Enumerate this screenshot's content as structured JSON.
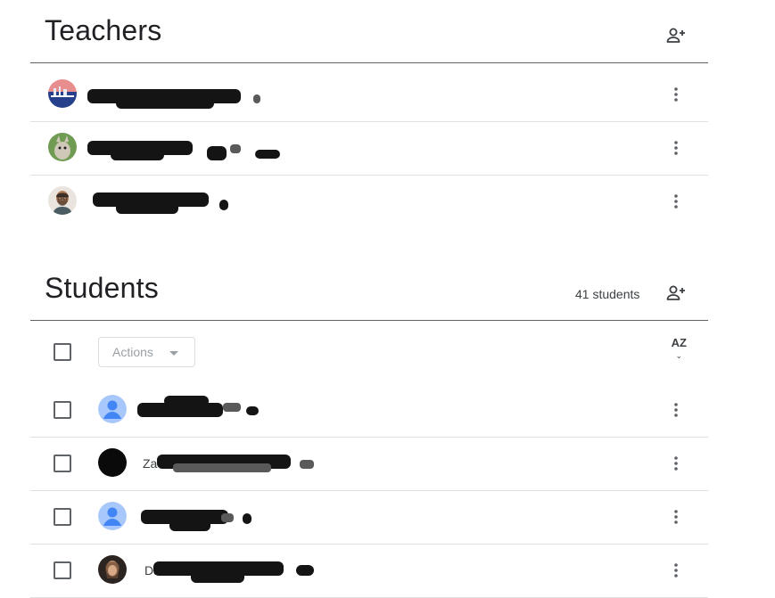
{
  "teachers": {
    "title": "Teachers",
    "add_icon": "person-add-icon",
    "rows": [
      {
        "name": "",
        "avatar": "photo-city-sunset"
      },
      {
        "name": "",
        "avatar": "photo-cat"
      },
      {
        "name": "",
        "avatar": "photo-man-glasses"
      }
    ]
  },
  "students": {
    "title": "Students",
    "count": "41 students",
    "add_icon": "person-add-icon",
    "actions_label": "Actions",
    "sort_icon": "sort-az-icon",
    "sort_label": "AZ",
    "rows": [
      {
        "name": "",
        "avatar": "default-person-blue"
      },
      {
        "name": "Za",
        "avatar": "black-circle"
      },
      {
        "name": "",
        "avatar": "default-person-blue"
      },
      {
        "name": "Da",
        "avatar": "photo-person"
      }
    ]
  },
  "colors": {
    "text": "#202124",
    "divider": "#5f6368",
    "row_divider": "#e0e0e0",
    "avatar_blue": "#8ab4f8",
    "avatar_blue_dark": "#4285f4"
  }
}
